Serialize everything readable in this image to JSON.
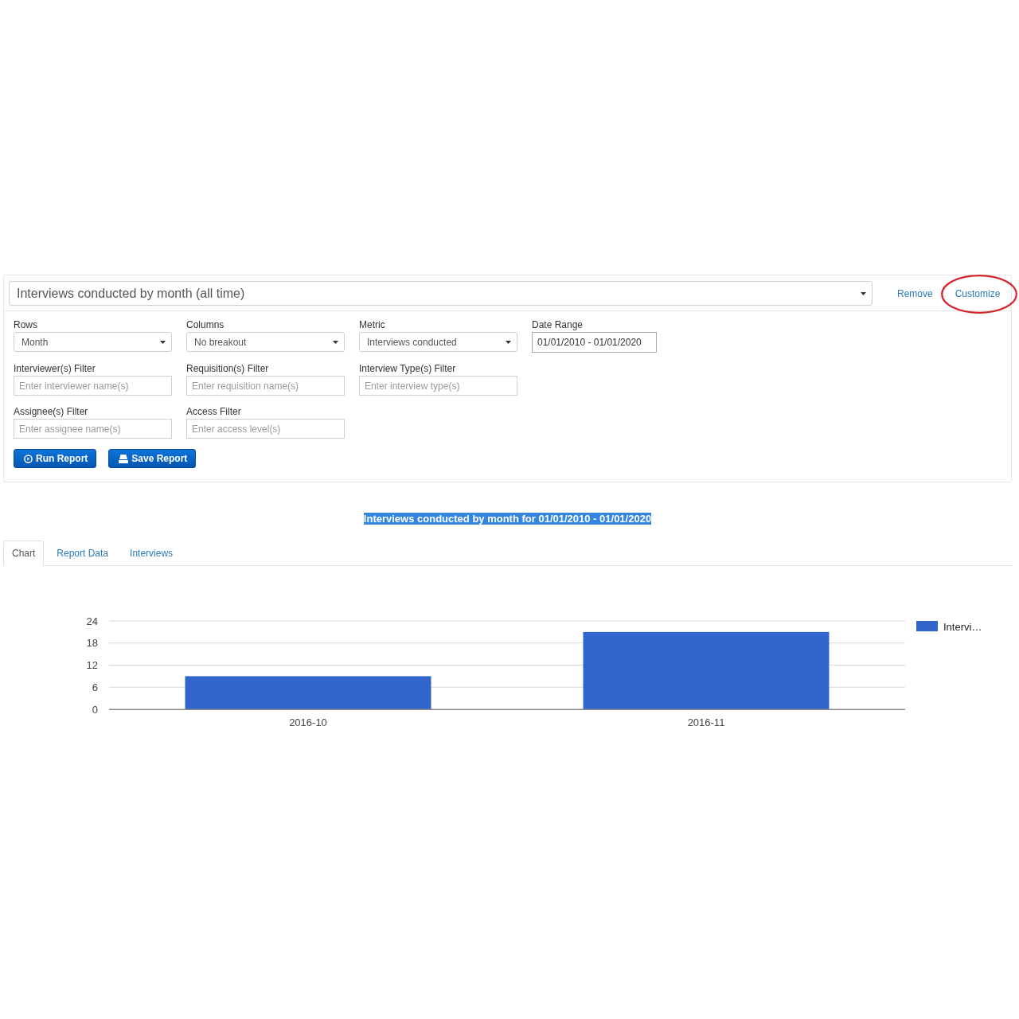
{
  "report_selector": {
    "value": "Interviews conducted by month (all time)"
  },
  "actions": [
    {
      "label": "Remove",
      "circled": false
    },
    {
      "label": "Customize",
      "circled": true
    }
  ],
  "filter_rows": [
    [
      {
        "kind": "select",
        "label": "Rows",
        "value": "Month"
      },
      {
        "kind": "select",
        "label": "Columns",
        "value": "No breakout"
      },
      {
        "kind": "select",
        "label": "Metric",
        "value": "Interviews conducted"
      },
      {
        "kind": "date_range",
        "label": "Date Range",
        "value": "01/01/2010 - 01/01/2020"
      }
    ],
    [
      {
        "kind": "text",
        "label": "Interviewer(s) Filter",
        "placeholder": "Enter interviewer name(s)"
      },
      {
        "kind": "text",
        "label": "Requisition(s) Filter",
        "placeholder": "Enter requisition name(s)"
      },
      {
        "kind": "text",
        "label": "Interview Type(s) Filter",
        "placeholder": "Enter interview type(s)"
      }
    ],
    [
      {
        "kind": "text",
        "label": "Assignee(s) Filter",
        "placeholder": "Enter assignee name(s)"
      },
      {
        "kind": "text",
        "label": "Access Filter",
        "placeholder": "Enter access level(s)"
      }
    ]
  ],
  "buttons": [
    {
      "kind": "run",
      "label": "Run Report"
    },
    {
      "kind": "save",
      "label": "Save Report"
    }
  ],
  "report_title": {
    "text": "Interviews conducted by month for 01/01/2010 - 01/01/2020",
    "highlighted": true
  },
  "tabs": [
    {
      "label": "Chart",
      "selected": true
    },
    {
      "label": "Report Data",
      "selected": false
    },
    {
      "label": "Interviews",
      "selected": false
    }
  ],
  "chart": {
    "chart_data": {
      "type": "bar",
      "categories": [
        "2016-10",
        "2016-11"
      ],
      "series": [
        {
          "name": "Intervi…",
          "color": "#3366cc",
          "values": [
            9,
            21
          ]
        }
      ],
      "ylim": [
        0,
        24
      ],
      "yticks": [
        0,
        6,
        12,
        18,
        24
      ],
      "grid": true
    }
  }
}
